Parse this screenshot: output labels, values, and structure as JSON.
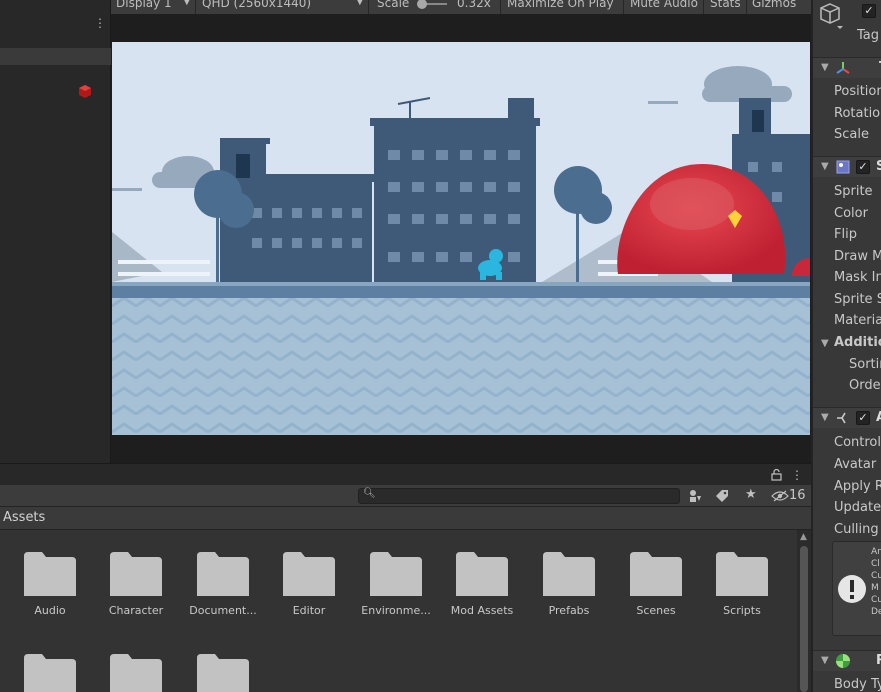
{
  "game_view": {
    "display": "Display 1",
    "resolution": "QHD (2560x1440)",
    "scale_label": "Scale",
    "scale_value": "0.32x",
    "maximize": "Maximize On Play",
    "mute": "Mute Audio",
    "stats": "Stats",
    "gizmos": "Gizmos"
  },
  "inspector": {
    "tag_label": "Tag",
    "transform_header": "T",
    "transform_fields": [
      "Position",
      "Rotation",
      "Scale"
    ],
    "sprite_header": "S",
    "sprite_fields": [
      "Sprite",
      "Color",
      "Flip",
      "Draw M",
      "Mask In",
      "Sprite S",
      "Materia"
    ],
    "additional": "Additio",
    "additional_fields": [
      "Sortin",
      "Order"
    ],
    "animator_header": "A",
    "animator_fields": [
      "Controll",
      "Avatar",
      "Apply R",
      "Update",
      "Culling"
    ],
    "warning_lines": [
      "An",
      "Cl",
      "Cu",
      "M",
      "Cu",
      "De"
    ],
    "body_header": "R",
    "body_field": "Body Ty"
  },
  "project": {
    "hidden_count": "16",
    "breadcrumb": "Assets",
    "folders": [
      "Audio",
      "Character",
      "Document...",
      "Editor",
      "Environme...",
      "Mod Assets",
      "Prefabs",
      "Scenes",
      "Scripts",
      "",
      "",
      ""
    ]
  }
}
